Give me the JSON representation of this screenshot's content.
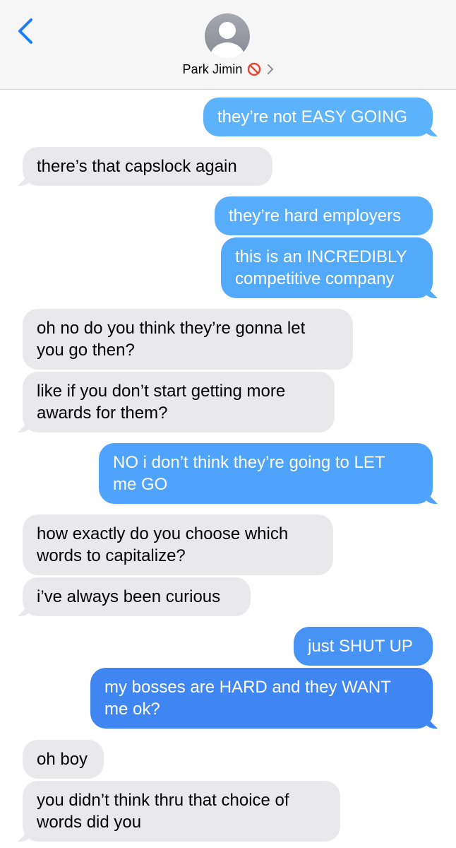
{
  "header": {
    "contact_name": "Park Jimin",
    "back_icon": "chevron-left-icon",
    "status_icon": "blocked-icon",
    "detail_icon": "chevron-right-icon"
  },
  "colors": {
    "accent": "#1a7ef7",
    "incoming_bubble": "#e9e9eb",
    "outgoing_top": "#5fb3fc",
    "outgoing_bottom": "#3f84f1"
  },
  "messages": [
    {
      "from": "me",
      "text": "they’re not EASY GOING"
    },
    {
      "from": "them",
      "text": "there’s that capslock again"
    },
    {
      "from": "me",
      "text": "they’re hard employers"
    },
    {
      "from": "me",
      "text": "this is an INCREDIBLY\ncompetitive company"
    },
    {
      "from": "them",
      "text": "oh no do you think they’re gonna let\nyou go then?"
    },
    {
      "from": "them",
      "text": "like if you don’t start getting more\nawards for them?"
    },
    {
      "from": "me",
      "text": "NO i don’t think they’re going to LET\nme GO"
    },
    {
      "from": "them",
      "text": "how exactly do you choose which\nwords to capitalize?"
    },
    {
      "from": "them",
      "text": "i’ve always been curious"
    },
    {
      "from": "me",
      "text": "just SHUT UP"
    },
    {
      "from": "me",
      "text": "my bosses are HARD and they WANT\nme ok?"
    },
    {
      "from": "them",
      "text": "oh boy"
    },
    {
      "from": "them",
      "text": "you didn’t think thru that choice of\nwords did you"
    }
  ]
}
